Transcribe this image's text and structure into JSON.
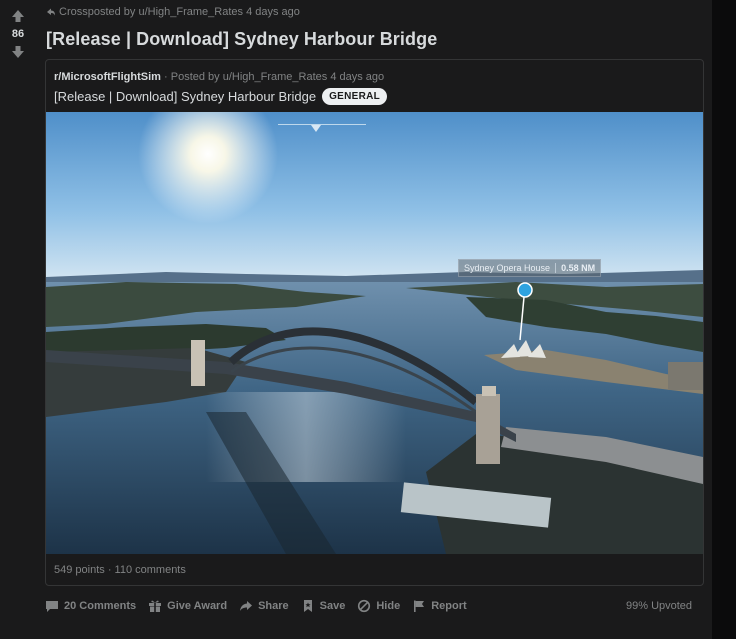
{
  "post": {
    "score": "86",
    "crosspost_text": "Crossposted by u/High_Frame_Rates 4 days ago",
    "title": "[Release | Download] Sydney Harbour Bridge",
    "upvoted": "99% Upvoted"
  },
  "crosspost": {
    "subreddit": "r/MicrosoftFlightSim",
    "posted_by": "· Posted by u/High_Frame_Rates 4 days ago",
    "title": "[Release | Download] Sydney Harbour Bridge",
    "flair": "GENERAL",
    "footer": "549 points · 110 comments",
    "image_label": {
      "place": "Sydney Opera House",
      "distance": "0.58 NM"
    }
  },
  "actions": {
    "comments": "20 Comments",
    "award": "Give Award",
    "share": "Share",
    "save": "Save",
    "hide": "Hide",
    "report": "Report"
  },
  "colors": {
    "background": "#1a1a1b",
    "text": "#d7dadc",
    "muted": "#818384",
    "border": "#343536"
  }
}
